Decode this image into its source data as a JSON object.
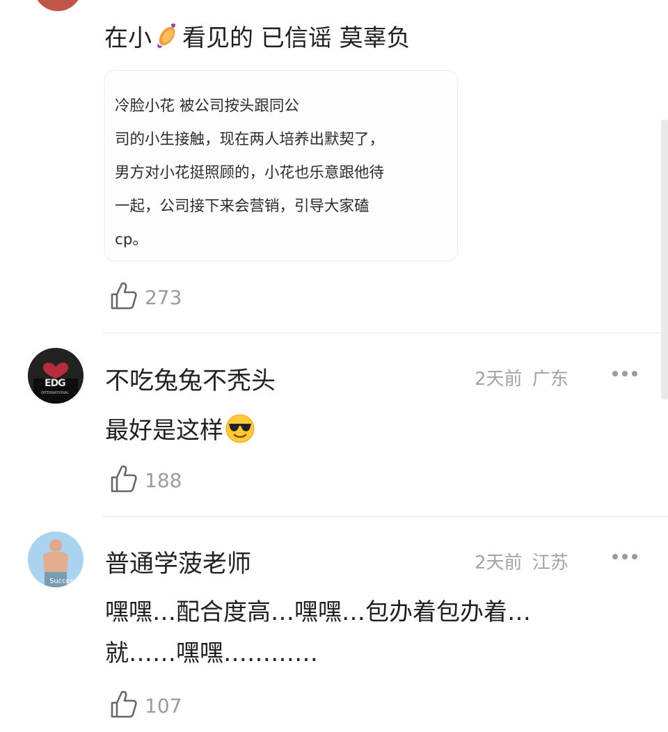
{
  "top_comment": {
    "text_before": "在小",
    "emoji": "sweet-potato-emoji",
    "text_after": "看见的 已信谣 莫辜负",
    "quote_lines": [
      "冷脸小花                           被公司按头跟同公",
      "司的小生接触，现在两人培养出默契了，",
      "男方对小花挺照顾的，小花也乐意跟他待",
      "一起，公司接下来会营销，引导大家磕",
      "cp。"
    ],
    "likes": "273"
  },
  "comments": [
    {
      "username": "不吃兔兔不秃头",
      "time": "2天前",
      "location": "广东",
      "text": "最好是这样",
      "emoji": "sunglasses-emoji",
      "likes": "188",
      "avatar_label": "EDG",
      "avatar_sublabel": "INTERNATIONAL"
    },
    {
      "username": "普通学菠老师",
      "time": "2天前",
      "location": "江苏",
      "lines": [
        "嘿嘿…配合度高…嘿嘿…包办着包办着…",
        "就……嘿嘿…………"
      ],
      "likes": "107",
      "avatar_label": "Success"
    }
  ],
  "colors": {
    "text": "#222222",
    "meta": "#a3a3a3",
    "like": "#9b9b9b",
    "divider": "#e6e6e6"
  }
}
